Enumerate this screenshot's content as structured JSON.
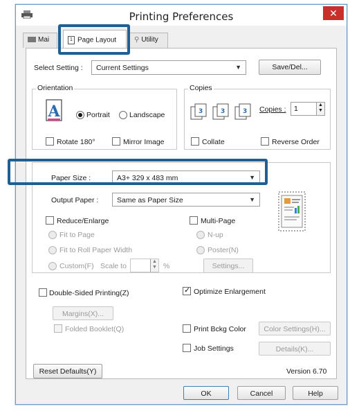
{
  "window": {
    "title": "Printing Preferences",
    "close_label": "✕"
  },
  "tabs": [
    {
      "label": "Mai"
    },
    {
      "label": "Page Layout"
    },
    {
      "label": "Utility"
    }
  ],
  "select_setting": {
    "label": "Select Setting :",
    "value": "Current Settings",
    "save_button": "Save/Del..."
  },
  "orientation": {
    "title": "Orientation",
    "portrait": "Portrait",
    "landscape": "Landscape",
    "rotate": "Rotate 180°",
    "mirror": "Mirror Image",
    "selected": "portrait"
  },
  "copies": {
    "title": "Copies",
    "copies_label": "Copies :",
    "copies_value": "1",
    "collate": "Collate",
    "reverse": "Reverse Order"
  },
  "paper": {
    "size_label": "Paper Size :",
    "size_value": "A3+ 329 x 483 mm",
    "output_label": "Output Paper :",
    "output_value": "Same as Paper Size"
  },
  "reduce": {
    "label": "Reduce/Enlarge",
    "fit_page": "Fit to Page",
    "fit_roll": "Fit to Roll Paper Width",
    "custom": "Custom(F)",
    "scale_to": "Scale to",
    "percent": "%"
  },
  "multipage": {
    "label": "Multi-Page",
    "nup": "N-up",
    "poster": "Poster(N)",
    "settings": "Settings..."
  },
  "double_sided": {
    "label": "Double-Sided Printing(Z)",
    "margins": "Margins(X)...",
    "folded": "Folded Booklet(Q)"
  },
  "optimize": {
    "label": "Optimize Enlargement",
    "checked": true
  },
  "print_bckg": {
    "label": "Print Bckg Color",
    "button": "Color Settings(H)..."
  },
  "job": {
    "label": "Job Settings",
    "button": "Details(K)..."
  },
  "footer": {
    "reset": "Reset Defaults(Y)",
    "version": "Version 6.70"
  },
  "dialog_buttons": {
    "ok": "OK",
    "cancel": "Cancel",
    "help": "Help"
  },
  "colors": {
    "highlight": "#1f5f94",
    "close": "#c9302c"
  }
}
